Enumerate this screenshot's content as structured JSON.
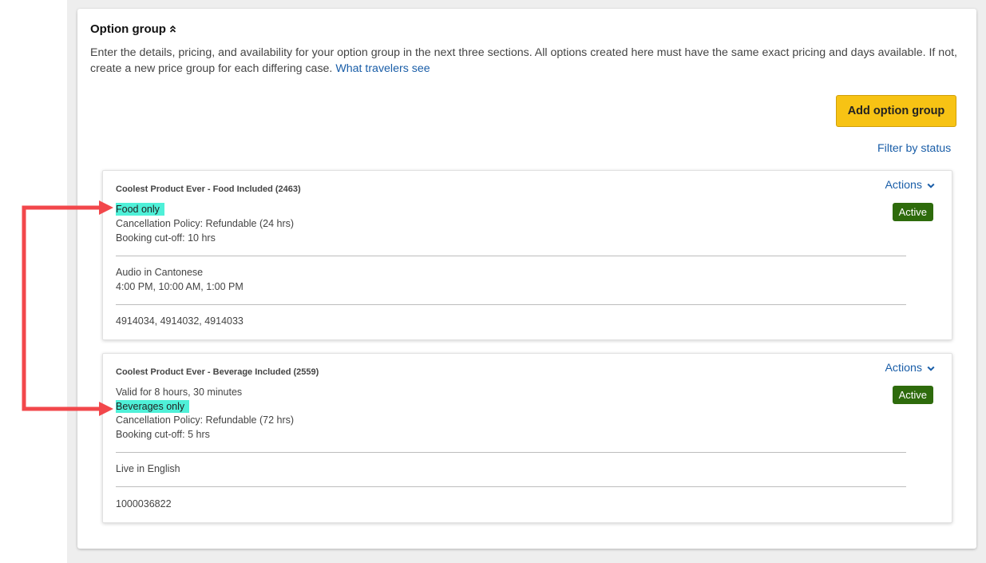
{
  "option_group": {
    "title": "Option group",
    "description": "Enter the details, pricing, and availability for your option group in the next three sections. All options created here must have the same exact pricing and days available. If not, create a new price group for each differing case.",
    "travelers_link": "What travelers see",
    "add_button_label": "Add option group",
    "filter_link": "Filter by status"
  },
  "cards": [
    {
      "title": "Coolest Product Ever - Food Included (2463)",
      "actions_label": "Actions",
      "status": "Active",
      "highlight": "Food only",
      "lines_a": [
        "Cancellation Policy: Refundable (24 hrs)",
        "Booking cut-off: 10 hrs"
      ],
      "lines_b": [
        "Audio in Cantonese",
        "4:00 PM, 10:00 AM, 1:00 PM"
      ],
      "ids": "4914034, 4914032, 4914033"
    },
    {
      "title": "Coolest Product Ever - Beverage Included (2559)",
      "actions_label": "Actions",
      "status": "Active",
      "pre_line": "Valid for 8 hours, 30 minutes",
      "highlight": "Beverages only",
      "lines_a": [
        "Cancellation Policy: Refundable (72 hrs)",
        "Booking cut-off: 5 hrs"
      ],
      "lines_b": [
        "Live in English"
      ],
      "ids": "1000036822"
    }
  ],
  "colors": {
    "accent_button": "#f7c314",
    "status_active": "#2e6b0c",
    "link": "#1a5ea8",
    "highlight": "#4ff0d8",
    "annotation_arrow": "#f2474b"
  },
  "icons": {
    "title_toggle": "chevron-up-double-icon",
    "actions_toggle": "chevron-down-icon"
  }
}
